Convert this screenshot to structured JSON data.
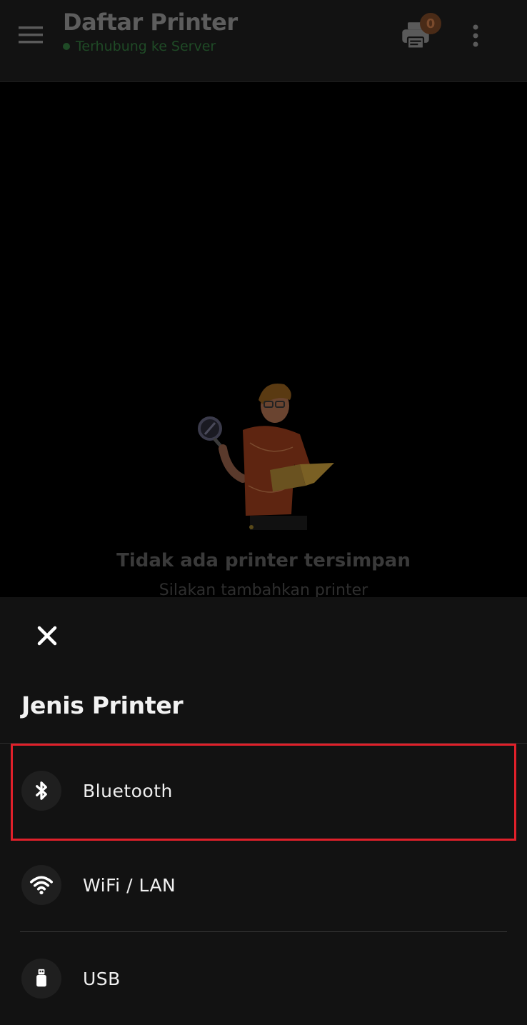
{
  "appbar": {
    "title": "Daftar Printer",
    "status": "Terhubung ke Server",
    "status_color": "#1f4a26",
    "queue_count": "0",
    "icons": {
      "menu": "menu-icon",
      "queue": "printer-icon",
      "more": "more-vertical-icon"
    }
  },
  "empty_state": {
    "title": "Tidak ada printer tersimpan",
    "subtitle": "Silakan tambahkan printer"
  },
  "sheet": {
    "title": "Jenis Printer",
    "close_icon": "close-icon",
    "options": [
      {
        "label": "Bluetooth",
        "icon": "bluetooth-icon",
        "highlighted": true
      },
      {
        "label": "WiFi / LAN",
        "icon": "wifi-icon",
        "highlighted": false
      },
      {
        "label": "USB",
        "icon": "usb-icon",
        "highlighted": false
      }
    ]
  },
  "colors": {
    "sheet_bg": "#121212",
    "highlight": "#e0202a",
    "text": "#f0f0f0"
  }
}
